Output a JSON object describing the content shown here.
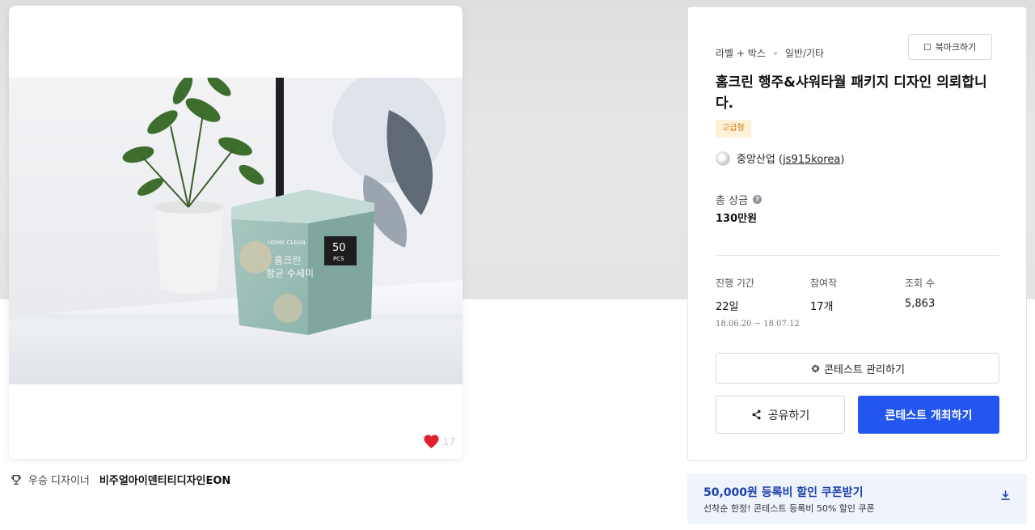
{
  "image_card": {
    "like_count": "17",
    "box_brand": "HOME CLEAN",
    "box_product_line1": "홈크린",
    "box_product_line2": "항균 수세미",
    "box_count": "50",
    "box_count_unit": "PCS"
  },
  "winner": {
    "label": "우승 디자이너",
    "name": "비주얼아이덴티티디자인EON"
  },
  "panel": {
    "category_primary": "라벨 + 박스",
    "category_secondary": "일반/기타",
    "bookmark_label": "북마크하기",
    "title": "홈크린 행주&샤워타월 패키지 디자인 의뢰합니다.",
    "badge": "고급형",
    "owner_name": "중앙산업",
    "owner_id": "js915korea",
    "prize_label": "총 상금",
    "prize_value": "130만원",
    "stats": {
      "period_label": "진행 기간",
      "period_value": "22일",
      "period_range": "18.06.20 ~ 18.07.12",
      "entries_label": "참여작",
      "entries_value": "17개",
      "views_label": "조회 수",
      "views_value": "5,863"
    },
    "manage_label": "콘테스트 관리하기",
    "share_label": "공유하기",
    "host_label": "콘테스트 개최하기"
  },
  "coupon": {
    "title": "50,000원 등록비 할인 쿠폰받기",
    "subtitle": "선착순 한정! 콘테스트 등록비 50% 할인 쿠폰"
  },
  "colors": {
    "accent": "#2355f0",
    "badge_text": "#d4780e",
    "coupon_title": "#1a3fae",
    "heart": "#e0202a"
  }
}
